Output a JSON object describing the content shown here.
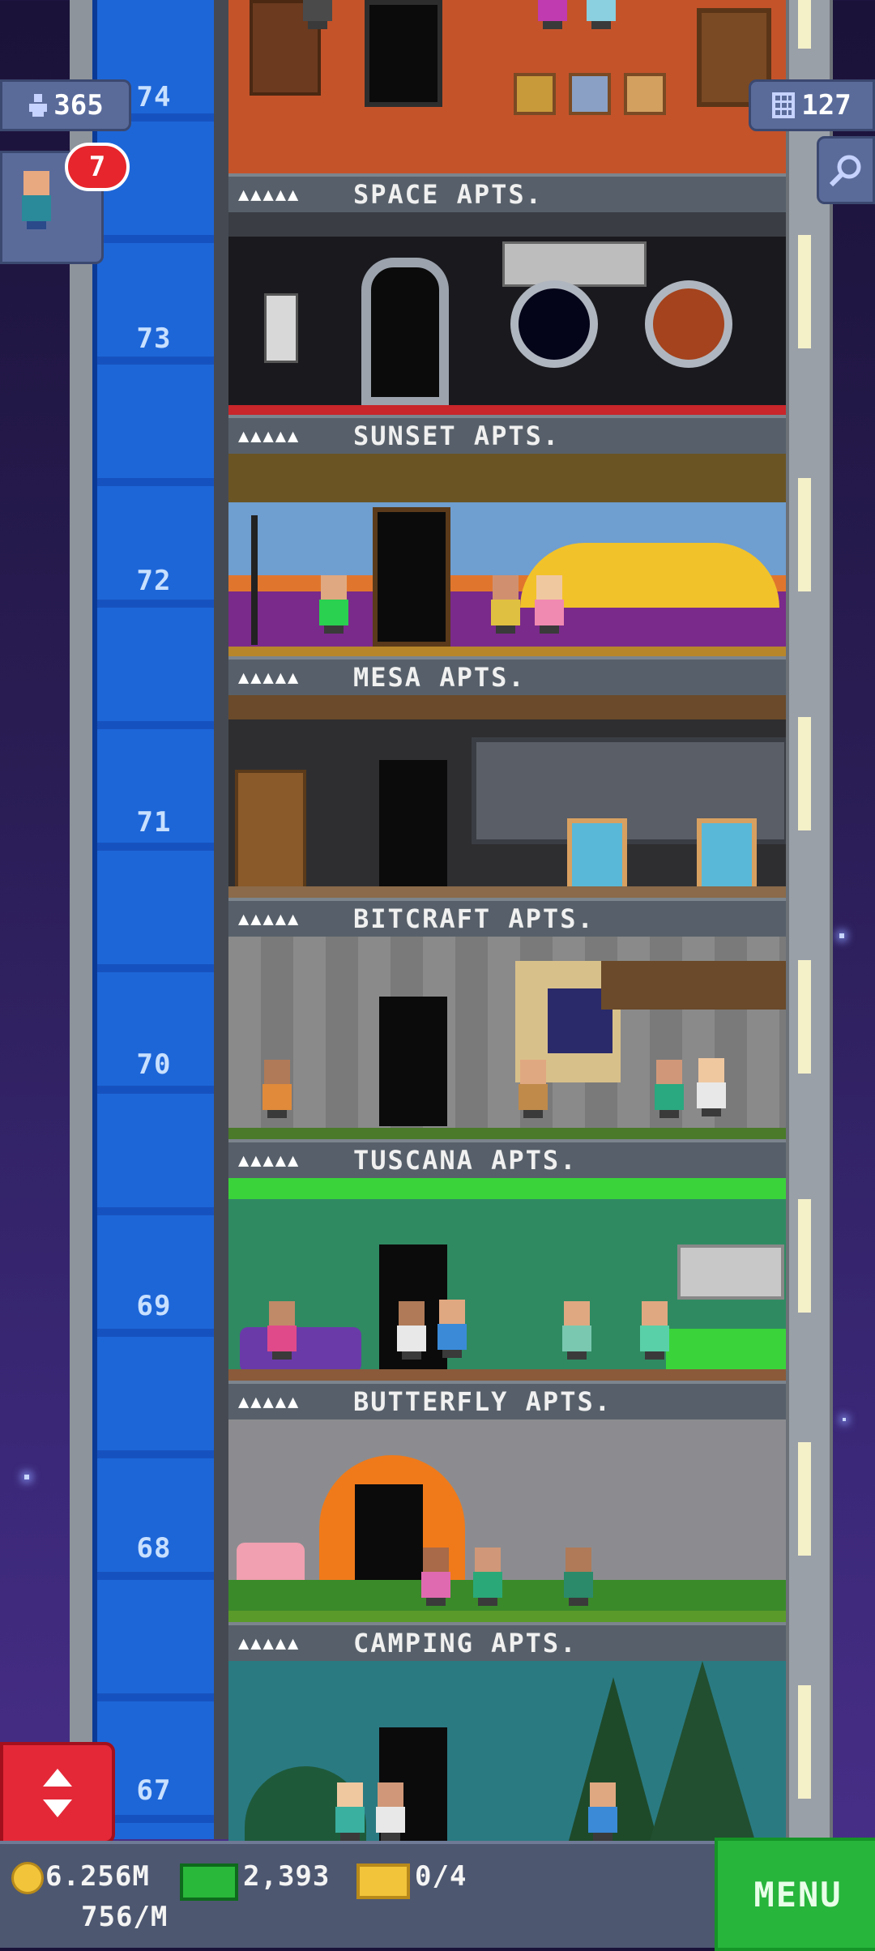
{
  "hud": {
    "population": "365",
    "floors": "127",
    "visitor_badge": "7",
    "coins": "6.256M",
    "income": "756/M",
    "bux": "2,393",
    "tickets": "0/4",
    "menu_label": "MENU"
  },
  "shaft_numbers": [
    "74",
    "73",
    "72",
    "71",
    "70",
    "69",
    "68",
    "67"
  ],
  "floors": [
    {
      "name": "SPACE APTS.",
      "dots": "▲▲▲▲▲"
    },
    {
      "name": "SUNSET APTS.",
      "dots": "▲▲▲▲▲"
    },
    {
      "name": "MESA APTS.",
      "dots": "▲▲▲▲▲"
    },
    {
      "name": "BITCRAFT APTS.",
      "dots": "▲▲▲▲▲"
    },
    {
      "name": "TUSCANA APTS.",
      "dots": "▲▲▲▲▲"
    },
    {
      "name": "BUTTERFLY APTS.",
      "dots": "▲▲▲▲▲"
    },
    {
      "name": "CAMPING APTS.",
      "dots": "▲▲▲▲▲"
    }
  ],
  "colors": {
    "elevator": "#1d66d8",
    "menu": "#27b53c",
    "alert": "#e6262c"
  },
  "icons": [
    "person-icon",
    "floors-icon",
    "search-icon",
    "coin-icon",
    "bux-icon",
    "ticket-icon",
    "elevator-arrows-icon"
  ]
}
